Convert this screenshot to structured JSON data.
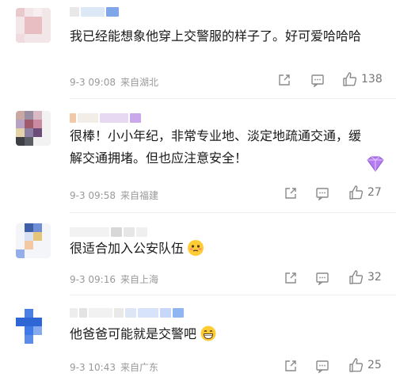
{
  "comments": [
    {
      "text": "我已经能想象他穿上交警服的样子了。好可爱哈哈哈",
      "date": "9-3 09:08",
      "source": "来自湖北",
      "likes": "138"
    },
    {
      "text": "很棒！小小年纪，非常专业地、淡定地疏通交通，缓解交通拥堵。但也应注意安全！",
      "date": "9-3 09:58",
      "source": "来自福建",
      "likes": "27"
    },
    {
      "text": "很适合加入公安队伍",
      "date": "9-3 09:16",
      "source": "来自上海",
      "likes": "32"
    },
    {
      "text": "他爸爸可能就是交警吧",
      "date": "9-3 10:43",
      "source": "来自广东",
      "likes": "25"
    }
  ],
  "icons": {
    "share": "share-icon",
    "comment": "comment-icon",
    "like": "thumbs-up-icon",
    "badge": "heart-badge-icon",
    "emoji_blush": "flushed-emoji-icon",
    "emoji_grin": "grinning-emoji-icon"
  },
  "colors": {
    "meta_text": "#999999",
    "icon": "#8a8a8a",
    "badge": "#b57cf0"
  }
}
